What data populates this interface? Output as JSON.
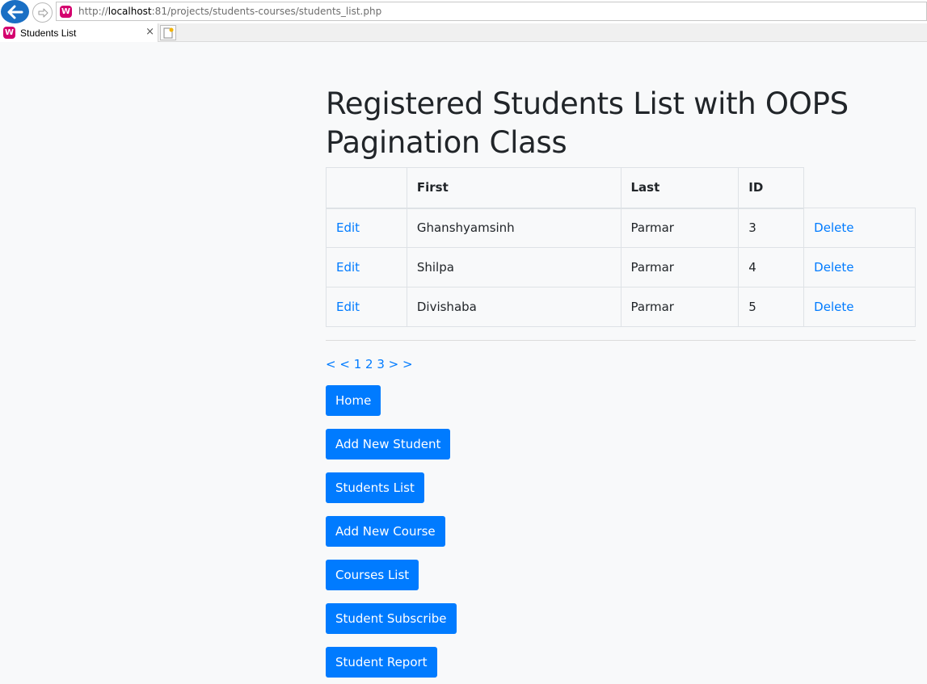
{
  "browser": {
    "url_prefix": "http://",
    "url_host": "localhost",
    "url_rest": ":81/projects/students-courses/students_list.php",
    "tab_title": "Students List",
    "tab_icon_letter": "W",
    "close_glyph": "×"
  },
  "page": {
    "title": "Registered Students List with OOPS Pagination Class",
    "table": {
      "headers": [
        "",
        "First",
        "Last",
        "ID",
        ""
      ],
      "rows": [
        {
          "edit": "Edit",
          "first": "Ghanshyamsinh",
          "last": "Parmar",
          "id": "3",
          "delete": "Delete"
        },
        {
          "edit": "Edit",
          "first": "Shilpa",
          "last": "Parmar",
          "id": "4",
          "delete": "Delete"
        },
        {
          "edit": "Edit",
          "first": "Divishaba",
          "last": "Parmar",
          "id": "5",
          "delete": "Delete"
        }
      ]
    },
    "pagination": {
      "prev": "< <",
      "pages": [
        "1",
        "2",
        "3"
      ],
      "next": "> >"
    },
    "buttons": {
      "home": "Home",
      "add_student": "Add New Student",
      "students_list": "Students List",
      "add_course": "Add New Course",
      "courses_list": "Courses List",
      "subscribe": "Student Subscribe",
      "report": "Student Report"
    }
  },
  "colors": {
    "primary": "#007bff",
    "background": "#f8f9fa",
    "text": "#212529"
  }
}
